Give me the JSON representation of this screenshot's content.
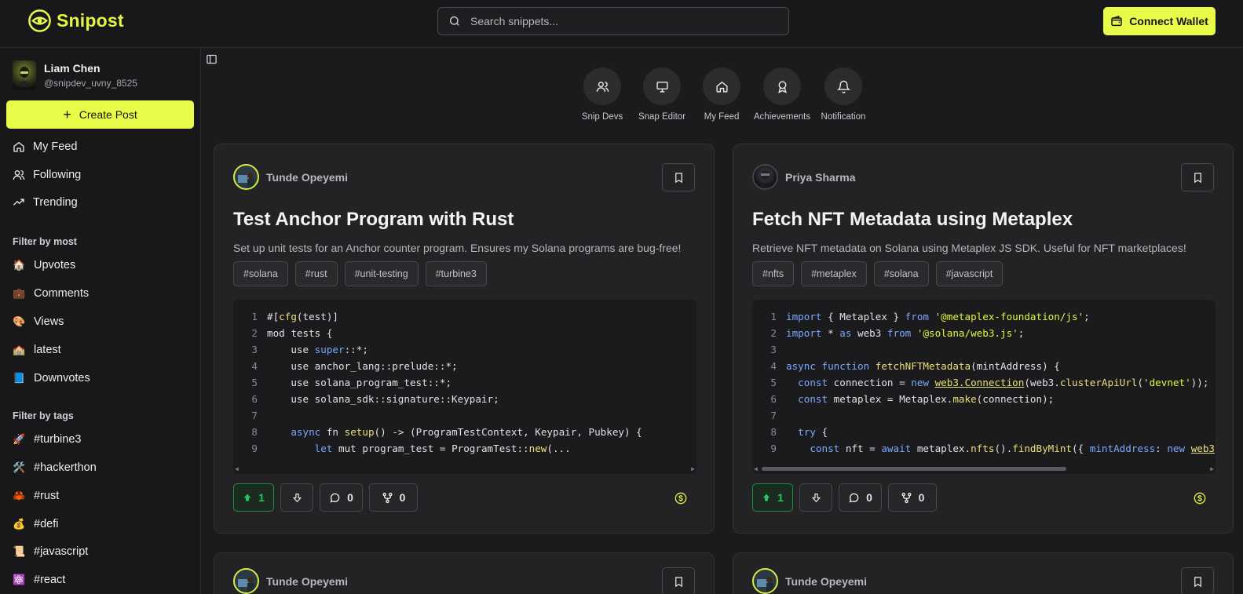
{
  "header": {
    "logo_text": "Snipost",
    "search_placeholder": "Search snippets...",
    "connect_label": "Connect Wallet",
    "accent": "#e9fb49"
  },
  "sidebar": {
    "user_name": "Liam Chen",
    "user_handle": "@snipdev_uvny_8525",
    "create_label": "Create Post",
    "nav": [
      {
        "label": "My Feed",
        "icon": "home-icon"
      },
      {
        "label": "Following",
        "icon": "users-icon"
      },
      {
        "label": "Trending",
        "icon": "trending-icon"
      }
    ],
    "filter_most_title": "Filter by most",
    "filter_most": [
      {
        "emoji": "🏠",
        "label": "Upvotes"
      },
      {
        "emoji": "💼",
        "label": "Comments"
      },
      {
        "emoji": "🎨",
        "label": "Views"
      },
      {
        "emoji": "🏫",
        "label": "latest"
      },
      {
        "emoji": "📘",
        "label": "Downvotes"
      }
    ],
    "filter_tags_title": "Filter by tags",
    "filter_tags": [
      {
        "emoji": "🚀",
        "label": "#turbine3"
      },
      {
        "emoji": "🛠️",
        "label": "#hackerthon"
      },
      {
        "emoji": "🦀",
        "label": "#rust"
      },
      {
        "emoji": "💰",
        "label": "#defi"
      },
      {
        "emoji": "📜",
        "label": "#javascript"
      },
      {
        "emoji": "⚛️",
        "label": "#react"
      }
    ]
  },
  "quick_actions": [
    {
      "label": "Snip Devs",
      "icon": "users-icon"
    },
    {
      "label": "Snap Editor",
      "icon": "presentation-icon"
    },
    {
      "label": "My Feed",
      "icon": "home-icon"
    },
    {
      "label": "Achievements",
      "icon": "award-icon"
    },
    {
      "label": "Notification",
      "icon": "bell-icon"
    }
  ],
  "posts": [
    {
      "author": "Tunde Opeyemi",
      "title": "Test Anchor Program with Rust",
      "description": "Set up unit tests for an Anchor counter program. Ensures my Solana programs are bug-free!",
      "tags": [
        "#solana",
        "#rust",
        "#unit-testing",
        "#turbine3"
      ],
      "upvotes": "1",
      "comments": "0",
      "forks": "0"
    },
    {
      "author": "Priya Sharma",
      "title": "Fetch NFT Metadata using Metaplex",
      "description": "Retrieve NFT metadata on Solana using Metaplex JS SDK. Useful for NFT marketplaces!",
      "tags": [
        "#nfts",
        "#metaplex",
        "#solana",
        "#javascript"
      ],
      "upvotes": "1",
      "comments": "0",
      "forks": "0"
    },
    {
      "author": "Tunde Opeyemi"
    },
    {
      "author": "Tunde Opeyemi"
    }
  ]
}
